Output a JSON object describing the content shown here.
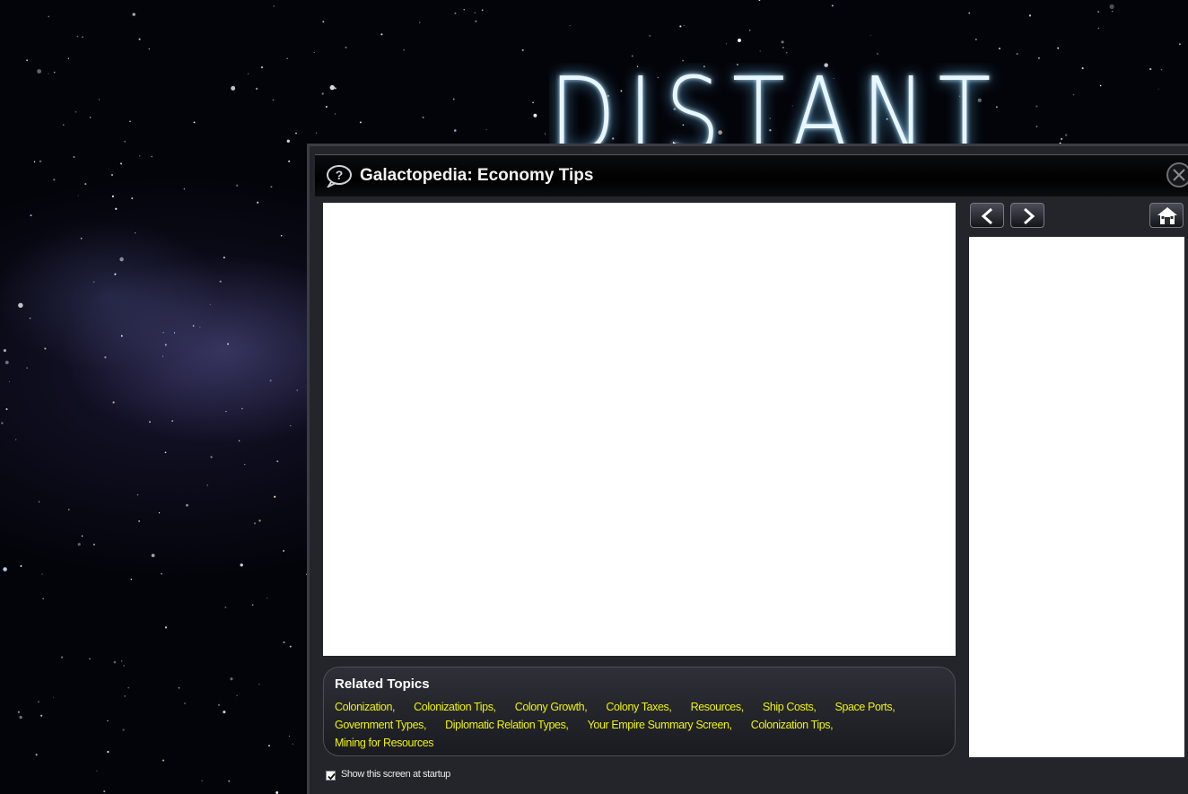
{
  "background": {
    "logo_text": "DISTANT"
  },
  "window": {
    "title": "Galactopedia: Economy Tips",
    "icons": {
      "help": "help-bubble-icon",
      "close": "close-x-icon",
      "back": "chevron-left-icon",
      "forward": "chevron-right-icon",
      "home": "home-icon"
    },
    "colors": {
      "link": "#eef20a",
      "panel": "#23252b",
      "titlebar": "#000000"
    }
  },
  "related_topics": {
    "heading": "Related Topics",
    "rows": [
      [
        "Colonization,",
        "Colonization Tips,",
        "Colony Growth,",
        "Colony Taxes,",
        "Resources,",
        "Ship Costs,",
        "Space Ports,"
      ],
      [
        "Government Types,",
        "Diplomatic Relation Types,",
        "Your Empire Summary Screen,",
        "Colonization Tips,"
      ],
      [
        "Mining for Resources"
      ]
    ]
  },
  "startup": {
    "label": "Show this screen at startup",
    "checked": true
  }
}
